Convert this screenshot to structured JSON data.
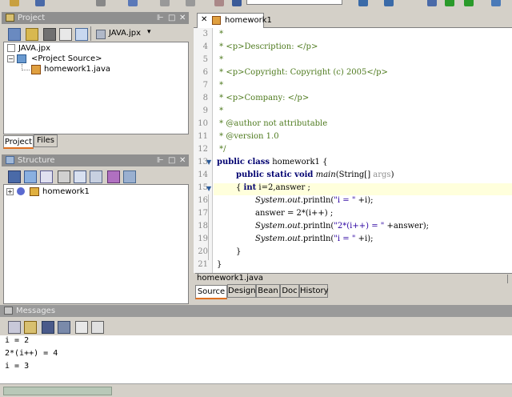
{
  "toolbar": {
    "icons": [
      "open-icon",
      "save-icon",
      "cut-icon",
      "run-icon",
      "debug-icon",
      "build-icon",
      "help-icon"
    ]
  },
  "project_panel": {
    "title": "Project",
    "controls": {
      "pin": "⊩",
      "max": "□",
      "close": "✕"
    },
    "project_selector": "JAVA.jpx",
    "tree": {
      "root": "JAVA.jpx",
      "source": "<Project Source>",
      "file": "homework1.java"
    },
    "tabs": [
      "Project",
      "Files"
    ]
  },
  "structure_panel": {
    "title": "Structure",
    "controls": {
      "pin": "⊩",
      "max": "□",
      "close": "✕"
    },
    "tree": {
      "class": "homework1"
    }
  },
  "editor": {
    "tab_label": "homework1",
    "status_file": "homework1.java",
    "bottom_tabs": [
      "Source",
      "Design",
      "Bean",
      "Doc",
      "History"
    ],
    "line_numbers": [
      "3",
      "4",
      "5",
      "6",
      "7",
      "8",
      "9",
      "10",
      "11",
      "12",
      "13",
      "14",
      "15",
      "16",
      "17",
      "18",
      "19",
      "20",
      "21"
    ],
    "lines": [
      {
        "t": "cmt",
        "text": " *"
      },
      {
        "t": "cmt",
        "text": " * <p>Description: </p>"
      },
      {
        "t": "cmt",
        "text": " *"
      },
      {
        "t": "cmt",
        "text": " * <p>Copyright: Copyright (c) 2005</p>"
      },
      {
        "t": "cmt",
        "text": " *"
      },
      {
        "t": "cmt",
        "text": " * <p>Company: </p>"
      },
      {
        "t": "cmt",
        "text": " *"
      },
      {
        "t": "cmt",
        "text": " * @author not attributable"
      },
      {
        "t": "cmt",
        "text": " * @version 1.0"
      },
      {
        "t": "cmt",
        "text": " */"
      }
    ],
    "code": {
      "l13": {
        "kw": "public class",
        "rest": " homework1 {"
      },
      "l14": {
        "kw": "public static void",
        "fn": "main",
        "args": "(String[] ",
        "argname": "args",
        "close": ")"
      },
      "l15": {
        "open": "{ ",
        "kw": "int",
        "rest": " i=2,answer ;"
      },
      "l16": {
        "cls": "System",
        "dot": ".",
        "fld": "out",
        "call": ".println(",
        "str": "\"i = \"",
        "tail": " +i);"
      },
      "l17": {
        "text": "answer = 2*(i++) ;"
      },
      "l18": {
        "cls": "System",
        "dot": ".",
        "fld": "out",
        "call": ".println(",
        "str": "\"2*(i++) = \"",
        "tail": " +answer);"
      },
      "l19": {
        "cls": "System",
        "dot": ".",
        "fld": "out",
        "call": ".println(",
        "str": "\"i = \"",
        "tail": " +i);"
      },
      "l20": {
        "text": "}"
      },
      "l21": {
        "text": "}"
      }
    }
  },
  "messages": {
    "title": "Messages",
    "output": [
      "i = 2",
      "2*(i++) = 4",
      "i = 3"
    ]
  }
}
